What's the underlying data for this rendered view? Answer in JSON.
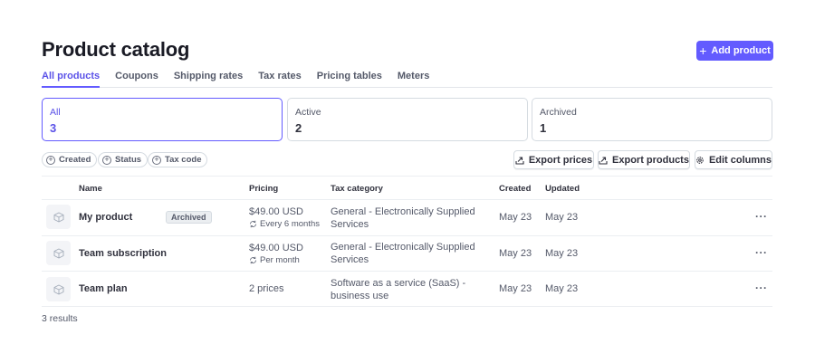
{
  "header": {
    "title": "Product catalog",
    "add_button_label": "Add product"
  },
  "tabs": [
    {
      "label": "All products",
      "active": true
    },
    {
      "label": "Coupons"
    },
    {
      "label": "Shipping rates"
    },
    {
      "label": "Tax rates"
    },
    {
      "label": "Pricing tables"
    },
    {
      "label": "Meters"
    }
  ],
  "summary_cards": [
    {
      "label": "All",
      "count": "3",
      "active": true
    },
    {
      "label": "Active",
      "count": "2"
    },
    {
      "label": "Archived",
      "count": "1"
    }
  ],
  "filters": [
    {
      "label": "Created",
      "icon": "plus-circle-icon"
    },
    {
      "label": "Status",
      "icon": "plus-circle-icon"
    },
    {
      "label": "Tax code",
      "icon": "plus-circle-icon"
    }
  ],
  "toolbar": {
    "export_prices_label": "Export prices",
    "export_products_label": "Export products",
    "edit_columns_label": "Edit columns"
  },
  "table": {
    "columns": [
      "Name",
      "Pricing",
      "Tax category",
      "Created",
      "Updated"
    ],
    "rows": [
      {
        "name": "My product",
        "badge": "Archived",
        "price": "$49.00 USD",
        "interval": "Every 6 months",
        "tax_line1": "General - Electronically Supplied",
        "tax_line2": "Services",
        "created": "May 23",
        "updated": "May 23",
        "menu": "···"
      },
      {
        "name": "Team subscription",
        "price": "$49.00 USD",
        "interval": "Per month",
        "tax_line1": "General - Electronically Supplied",
        "tax_line2": "Services",
        "created": "May 23",
        "updated": "May 23",
        "menu": "···"
      },
      {
        "name": "Team plan",
        "price": "2 prices",
        "tax_line1": "Software as a service (SaaS) -",
        "tax_line2": "business use",
        "created": "May 23",
        "updated": "May 23",
        "menu": "···"
      }
    ]
  },
  "footer": {
    "results_text": "3 results"
  },
  "colors": {
    "accent": "#635bff",
    "accent_text": "#5b52e8",
    "border": "#d5dbe1",
    "text": "#30313d",
    "muted": "#545969"
  }
}
